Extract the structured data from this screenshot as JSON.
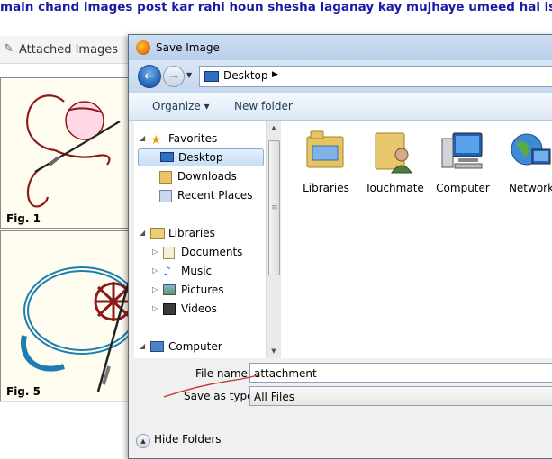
{
  "page": {
    "forum_title": "main chand images post kar rahi houn shesha laganay kay mujhaye umeed hai is say",
    "attached_images_label": "Attached Images",
    "thumbnails": [
      {
        "caption": "Fig. 1"
      },
      {
        "caption": "Fig. 5"
      }
    ]
  },
  "dialog": {
    "title": "Save Image",
    "address": {
      "current": "Desktop"
    },
    "toolbar": {
      "organize": "Organize ▾",
      "new_folder": "New folder"
    },
    "nav_pane": {
      "favorites": {
        "label": "Favorites",
        "items": [
          "Desktop",
          "Downloads",
          "Recent Places"
        ]
      },
      "libraries": {
        "label": "Libraries",
        "items": [
          "Documents",
          "Music",
          "Pictures",
          "Videos"
        ]
      },
      "computer": {
        "label": "Computer"
      }
    },
    "content_items": [
      "Libraries",
      "Touchmate",
      "Computer",
      "Network"
    ],
    "file_name": {
      "label": "File name:",
      "value": "attachment"
    },
    "save_as_type": {
      "label": "Save as type:",
      "value": "All Files"
    },
    "hide_folders": "Hide Folders"
  },
  "colors": {
    "forum_title": "#1a1aa6",
    "selection": "#c6def6",
    "sketch_red": "#8b1a1a",
    "sketch_blue": "#1c7fb0"
  }
}
